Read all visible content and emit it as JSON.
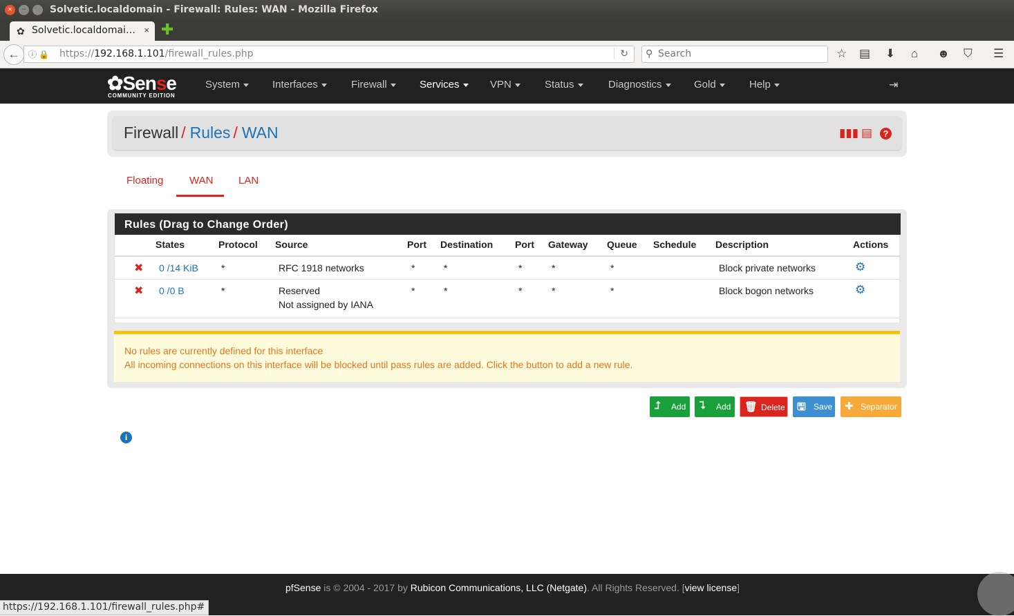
{
  "window": {
    "title": "Solvetic.localdomain - Firewall: Rules: WAN - Mozilla Firefox",
    "tab_label": "Solvetic.localdomai…",
    "tab_close": "×",
    "new_tab": "✚",
    "url_prefix": "https://",
    "url_host": "192.168.1.101",
    "url_path": "/firewall_rules.php",
    "search_placeholder": "Search"
  },
  "nav": {
    "logo_text_a": "Sen",
    "logo_text_b": "s",
    "logo_text_c": "e",
    "logo_sub": "COMMUNITY EDITION",
    "items": [
      {
        "label": "System"
      },
      {
        "label": "Interfaces"
      },
      {
        "label": "Firewall"
      },
      {
        "label": "Services"
      },
      {
        "label": "VPN"
      },
      {
        "label": "Status"
      },
      {
        "label": "Diagnostics"
      },
      {
        "label": "Gold"
      },
      {
        "label": "Help"
      }
    ]
  },
  "breadcrumb": {
    "root": "Firewall",
    "level2": "Rules",
    "level3": "WAN",
    "separator": "/"
  },
  "tabs": [
    {
      "label": "Floating"
    },
    {
      "label": "WAN"
    },
    {
      "label": "LAN"
    }
  ],
  "rules": {
    "panel_title": "Rules (Drag to Change Order)",
    "columns": [
      "States",
      "Protocol",
      "Source",
      "Port",
      "Destination",
      "Port",
      "Gateway",
      "Queue",
      "Schedule",
      "Description",
      "Actions"
    ],
    "rows": [
      {
        "states": "0 /14 KiB",
        "protocol": "*",
        "source": "RFC 1918 networks",
        "source_2": "",
        "port": "*",
        "destination": "*",
        "dport": "*",
        "gateway": "*",
        "queue": "*",
        "schedule": "",
        "description": "Block private networks"
      },
      {
        "states": "0 /0 B",
        "protocol": "*",
        "source": "Reserved",
        "source_2": "Not assigned by IANA",
        "port": "*",
        "destination": "*",
        "dport": "*",
        "gateway": "*",
        "queue": "*",
        "schedule": "",
        "description": "Block bogon networks"
      }
    ]
  },
  "alert": {
    "line1": "No rules are currently defined for this interface",
    "line2": "All incoming connections on this interface will be blocked until pass rules are added. Click the button to add a new rule."
  },
  "buttons": {
    "add_top": "Add",
    "add_bottom": "Add",
    "delete": "Delete",
    "save": "Save",
    "separator": "Separator"
  },
  "footer": {
    "brand": "pfSense",
    "is": " is © 2004 - 2017 by ",
    "company": "Rubicon Communications, LLC (Netgate)",
    "rights": ". All Rights Reserved. [",
    "license": "view license",
    "close": "]"
  },
  "status_url": "https://192.168.1.101/firewall_rules.php#",
  "colors": {
    "accent_red": "#d9251d",
    "link_blue": "#1d73b5",
    "alert_orange": "#e8741c",
    "alert_border": "#f7c30f",
    "btn_green": "#1aa03a",
    "btn_red": "#d9251d",
    "btn_blue": "#3d8fd1",
    "btn_orange": "#f7a93a"
  }
}
